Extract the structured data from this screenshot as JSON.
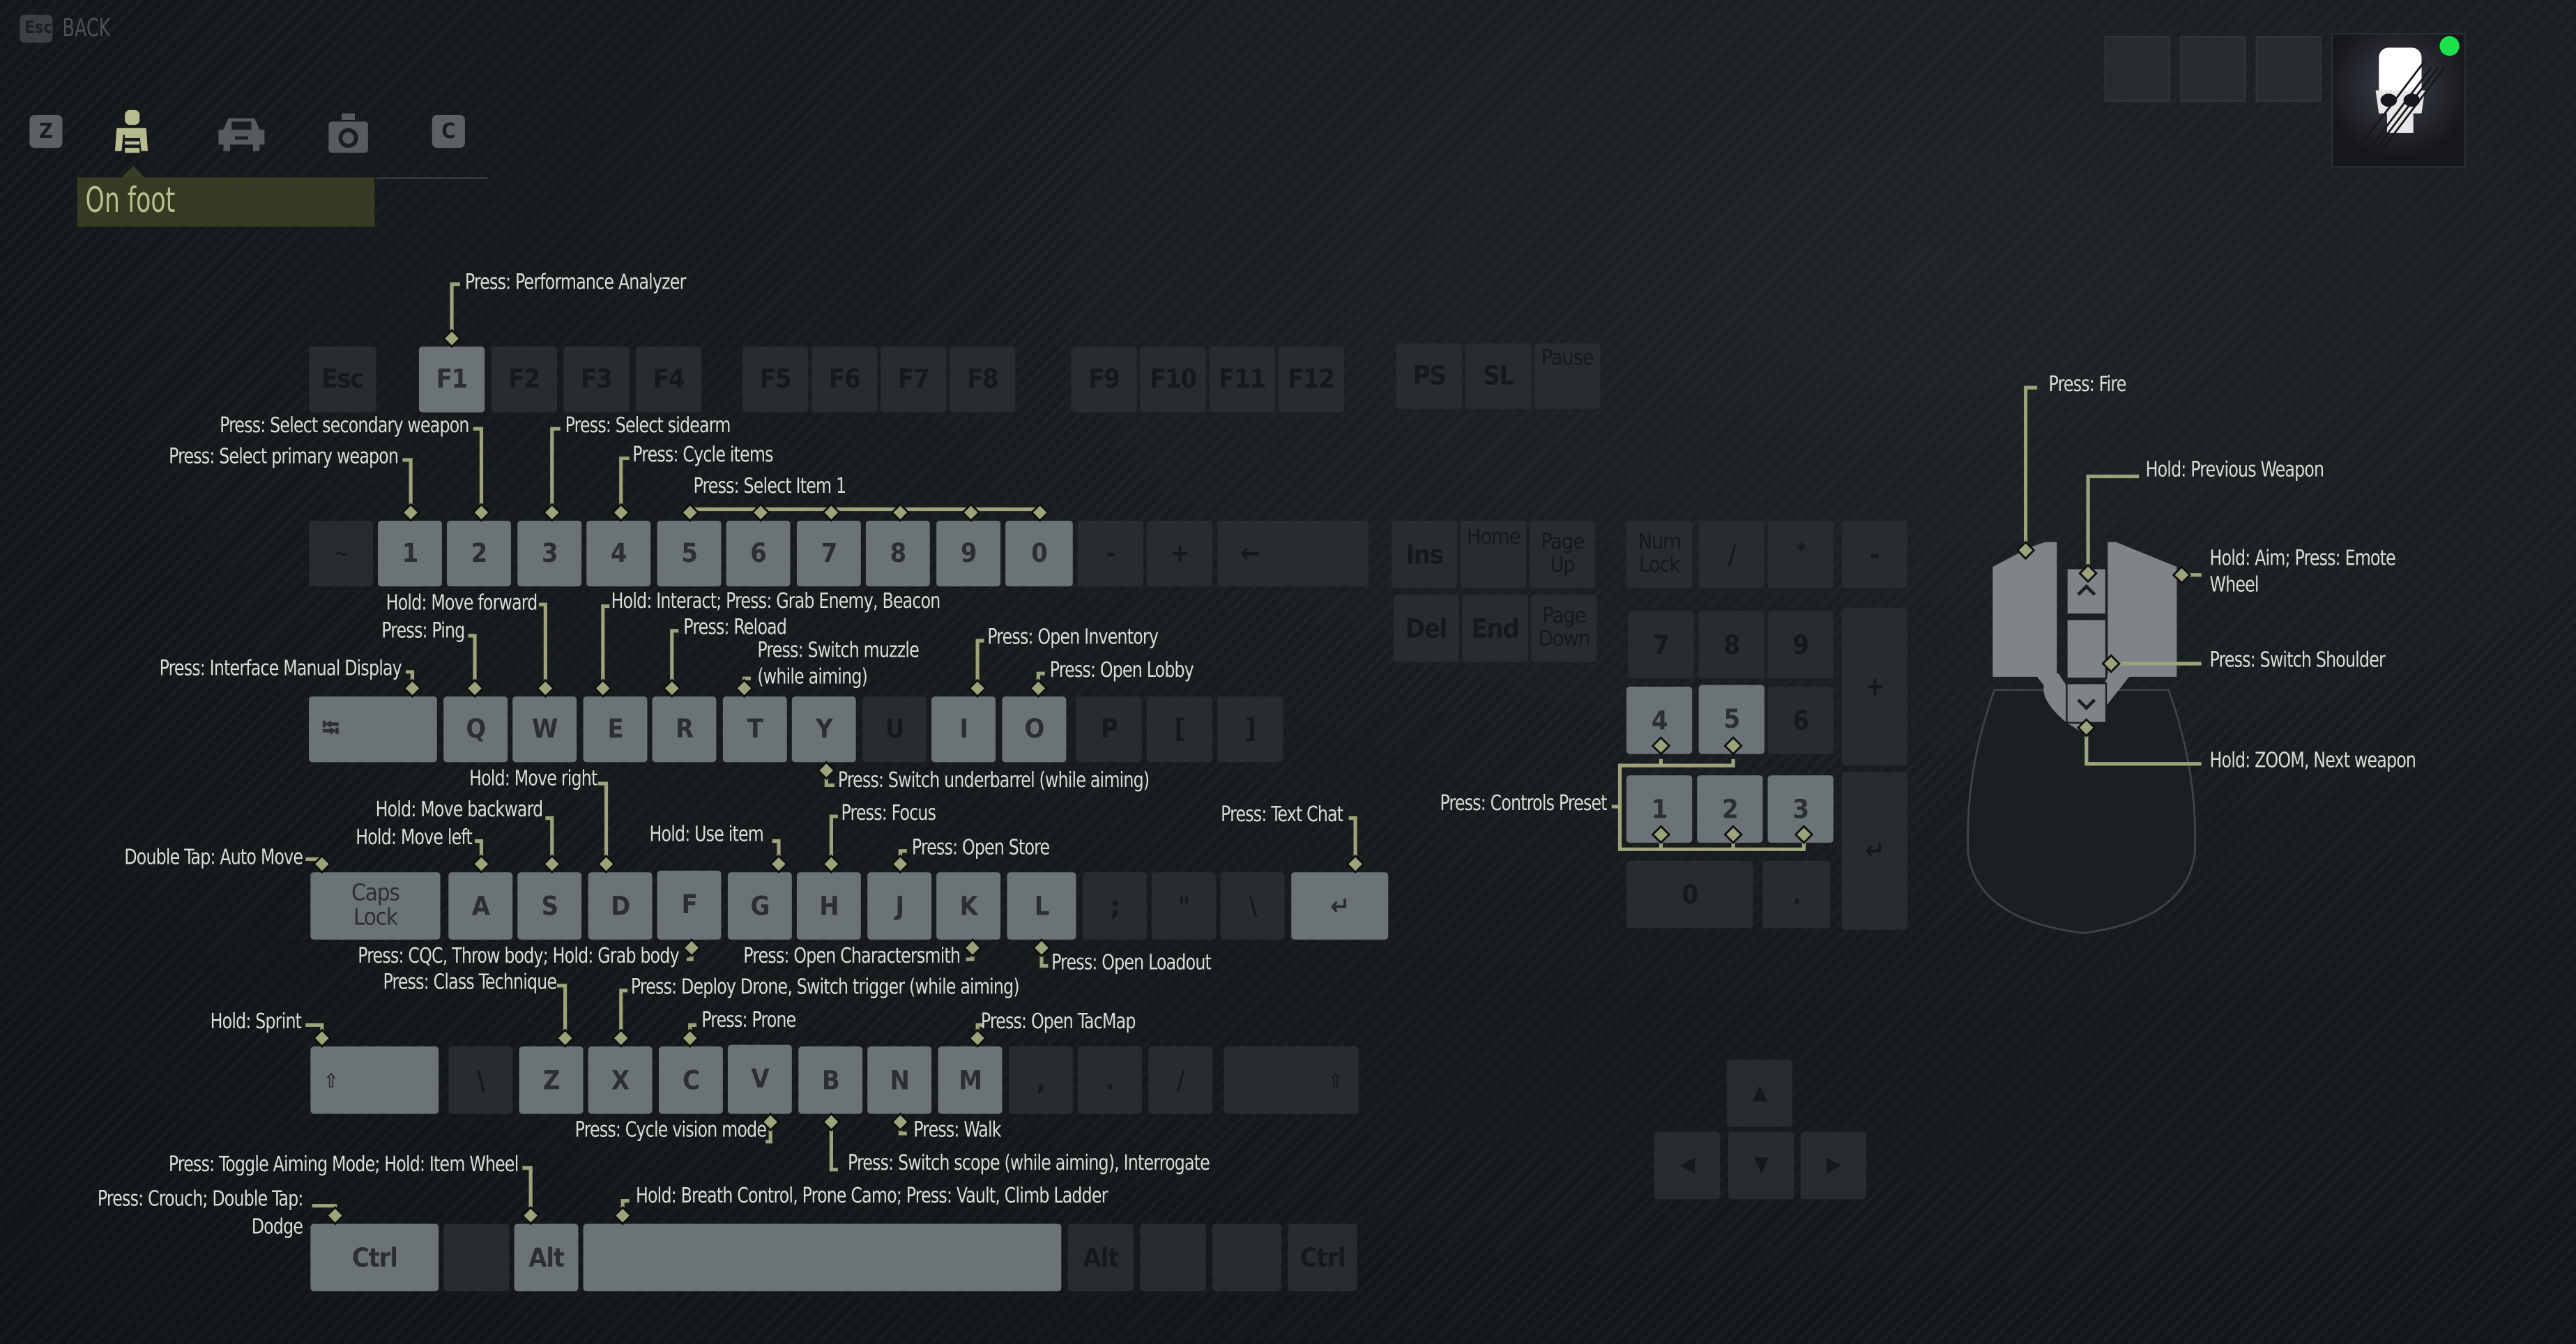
{
  "header": {
    "back_key": "Esc",
    "back_label": "BACK",
    "prev_tab_key": "Z",
    "next_tab_key": "C",
    "tabs": [
      {
        "name": "on-foot",
        "icon": "soldier-icon",
        "active": true
      },
      {
        "name": "vehicle",
        "icon": "vehicle-icon",
        "active": false
      },
      {
        "name": "drone",
        "icon": "drone-camera-icon",
        "active": false
      }
    ],
    "active_tab_label": "On foot",
    "status_color": "#1ee04a",
    "accent_color": "#9da27a"
  },
  "keys": {
    "function_row": [
      "Esc",
      "F1",
      "F2",
      "F3",
      "F4",
      "F5",
      "F6",
      "F7",
      "F8",
      "F9",
      "F10",
      "F11",
      "F12",
      "PS",
      "SL",
      "Pause"
    ],
    "number_row": [
      "~",
      "1",
      "2",
      "3",
      "4",
      "5",
      "6",
      "7",
      "8",
      "9",
      "0",
      "-",
      "+",
      "←"
    ],
    "qwerty_row": [
      "⭾",
      "Q",
      "W",
      "E",
      "R",
      "T",
      "Y",
      "U",
      "I",
      "O",
      "P",
      "[",
      "]"
    ],
    "home_row": [
      "Caps Lock",
      "A",
      "S",
      "D",
      "F",
      "G",
      "H",
      "J",
      "K",
      "L",
      ";",
      "\"",
      "\\",
      "↵"
    ],
    "shift_row": [
      "⇧",
      "\\",
      "Z",
      "X",
      "C",
      "V",
      "B",
      "N",
      "M",
      ",",
      ".",
      "/",
      "⇧"
    ],
    "bottom_row": [
      "Ctrl",
      "",
      "Alt",
      "",
      "Alt",
      "",
      "",
      "Ctrl"
    ],
    "nav_cluster": [
      "Ins",
      "Home",
      "Page Up",
      "Del",
      "End",
      "Page Down"
    ],
    "numpad": [
      "Num Lock",
      "/",
      "*",
      "-",
      "7",
      "8",
      "9",
      "+",
      "4",
      "5",
      "6",
      "1",
      "2",
      "3",
      "↵",
      "0",
      "."
    ],
    "arrows": [
      "▲",
      "◀",
      "▼",
      "▶"
    ],
    "bound": [
      "F1",
      "1",
      "2",
      "3",
      "4",
      "5",
      "6",
      "7",
      "8",
      "9",
      "0",
      "⭾",
      "Q",
      "W",
      "E",
      "R",
      "T",
      "Y",
      "I",
      "O",
      "Caps Lock",
      "A",
      "S",
      "D",
      "F",
      "G",
      "H",
      "J",
      "K",
      "L",
      "↵",
      "⇧",
      "Z",
      "X",
      "C",
      "V",
      "B",
      "N",
      "M",
      "Ctrl",
      "Alt",
      "Space",
      "Num4",
      "Num5",
      "Num1",
      "Num2",
      "Num3"
    ]
  },
  "bindings": {
    "f1": "Press: Performance Analyzer",
    "k1": "Press: Select primary weapon",
    "k2": "Press: Select secondary weapon",
    "k3": "Press: Select sidearm",
    "k4": "Press: Cycle items",
    "k5to0": "Press: Select Item 1",
    "tab": "Press: Interface Manual Display",
    "q": "Press: Ping",
    "w": "Hold: Move forward",
    "e": "Hold: Interact; Press: Grab Enemy, Beacon",
    "r": "Press: Reload",
    "t_line1": "Press: Switch muzzle",
    "t_line2": "(while aiming)",
    "y": "Press: Switch underbarrel (while aiming)",
    "i": "Press: Open Inventory",
    "o": "Press: Open Lobby",
    "caps": "Double Tap: Auto Move",
    "a": "Hold: Move left",
    "s": "Hold: Move backward",
    "d": "Hold: Move right",
    "f": "Press: CQC, Throw body; Hold: Grab body",
    "g": "Hold: Use item",
    "h": "Press: Focus",
    "j": "Press: Open Store",
    "k": "Press: Open Charactersmith",
    "l": "Press: Open Loadout",
    "enter": "Press: Text Chat",
    "shift": "Hold: Sprint",
    "z": "Press: Class Technique",
    "x": "Press: Deploy Drone, Switch trigger (while aiming)",
    "c": "Press: Prone",
    "v": "Press: Cycle vision mode",
    "b": "Press: Switch scope (while aiming), Interrogate",
    "n": "Press: Walk",
    "m": "Press: Open TacMap",
    "ctrl_line1": "Press: Crouch; Double Tap:",
    "ctrl_line2": "Dodge",
    "alt": "Press: Toggle Aiming Mode; Hold: Item Wheel",
    "space": "Hold: Breath Control, Prone Camo; Press: Vault, Climb Ladder",
    "numpad": "Press: Controls Preset"
  },
  "mouse": {
    "left": "Press: Fire",
    "wheel_up": "Hold: Previous Weapon",
    "right_line1": "Hold: Aim; Press: Emote",
    "right_line2": "Wheel",
    "wheel_click": "Press: Switch Shoulder",
    "wheel_down": "Hold: ZOOM, Next weapon"
  }
}
